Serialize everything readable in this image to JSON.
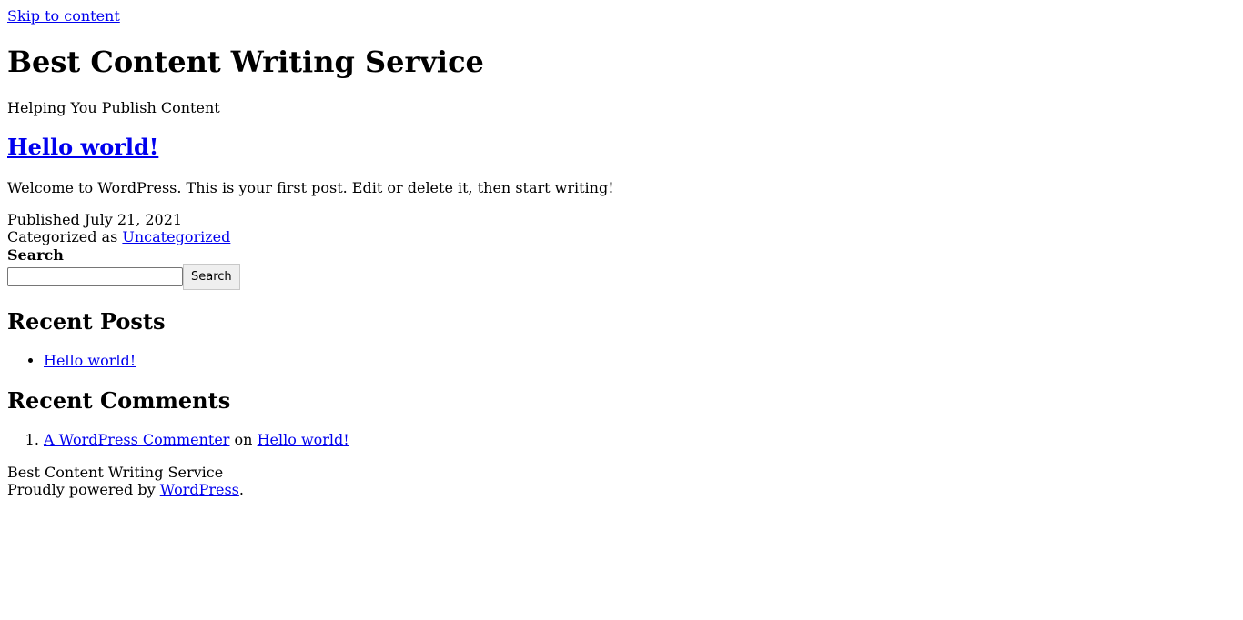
{
  "skip_link": "Skip to content",
  "site": {
    "title": "Best Content Writing Service",
    "tagline": "Helping You Publish Content"
  },
  "post": {
    "title": "Hello world!",
    "excerpt": "Welcome to WordPress. This is your first post. Edit or delete it, then start writing!",
    "published_prefix": "Published",
    "published_date": "July 21, 2021",
    "categorized_prefix": "Categorized as",
    "category": "Uncategorized"
  },
  "search": {
    "label": "Search",
    "input_value": "",
    "button_label": "Search"
  },
  "recent_posts": {
    "heading": "Recent Posts",
    "items": [
      {
        "label": "Hello world!"
      }
    ]
  },
  "recent_comments": {
    "heading": "Recent Comments",
    "items": [
      {
        "author": "A WordPress Commenter",
        "connector": "on",
        "post": "Hello world!"
      }
    ]
  },
  "footer": {
    "site_name": "Best Content Writing Service",
    "powered_prefix": "Proudly powered by",
    "powered_link": "WordPress",
    "powered_suffix": "."
  },
  "colors": {
    "link": "#0000ee",
    "text": "#000000",
    "background": "#ffffff"
  }
}
